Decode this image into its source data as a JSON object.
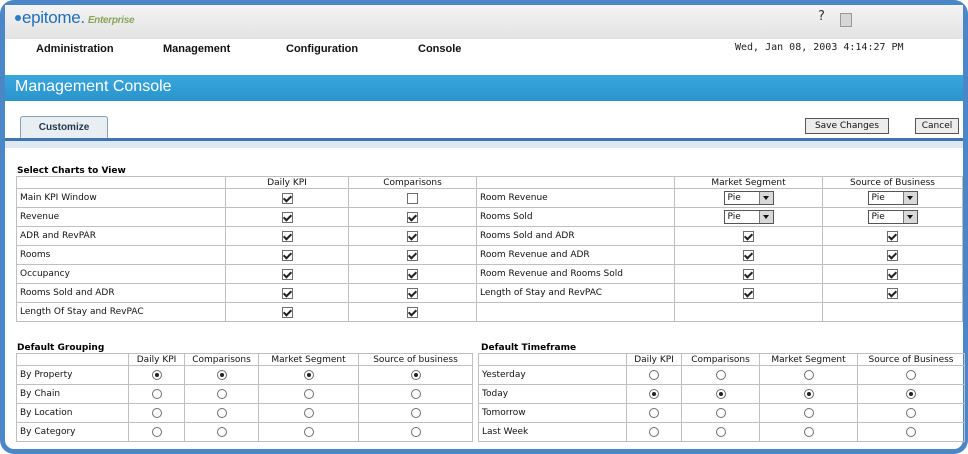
{
  "app": {
    "logo": "epitome.",
    "edition": "Enterprise",
    "help": "?"
  },
  "menu": [
    "Administration",
    "Management",
    "Configuration",
    "Console"
  ],
  "datetime": "Wed, Jan 08, 2003 4:14:27 PM",
  "page_title": "Management Console",
  "tab": "Customize",
  "buttons": {
    "save": "Save Changes",
    "cancel": "Cancel"
  },
  "select_charts": {
    "title": "Select Charts to View",
    "left": {
      "columns": [
        "Daily KPI",
        "Comparisons"
      ],
      "rows": [
        {
          "label": "Main KPI Window",
          "daily": true,
          "comp": false
        },
        {
          "label": "Revenue",
          "daily": true,
          "comp": true
        },
        {
          "label": "ADR and RevPAR",
          "daily": true,
          "comp": true
        },
        {
          "label": "Rooms",
          "daily": true,
          "comp": true
        },
        {
          "label": "Occupancy",
          "daily": true,
          "comp": true
        },
        {
          "label": "Rooms Sold and ADR",
          "daily": true,
          "comp": true
        },
        {
          "label": "Length Of Stay and RevPAC",
          "daily": true,
          "comp": true
        }
      ]
    },
    "right": {
      "columns": [
        "Market Segment",
        "Source of Business"
      ],
      "rows": [
        {
          "label": "Room Revenue",
          "market": "Pie",
          "source": "Pie"
        },
        {
          "label": "Rooms Sold",
          "market": "Pie",
          "source": "Pie"
        },
        {
          "label": "Rooms Sold and ADR",
          "market": true,
          "source": true
        },
        {
          "label": "Room Revenue and ADR",
          "market": true,
          "source": true
        },
        {
          "label": "Room Revenue and Rooms Sold",
          "market": true,
          "source": true
        },
        {
          "label": "Length of Stay and RevPAC",
          "market": true,
          "source": true
        }
      ]
    }
  },
  "default_grouping": {
    "title": "Default Grouping",
    "columns": [
      "Daily KPI",
      "Comparisons",
      "Market Segment",
      "Source of business"
    ],
    "rows": [
      {
        "label": "By Property",
        "selected": [
          true,
          true,
          true,
          true
        ]
      },
      {
        "label": "By Chain",
        "selected": [
          false,
          false,
          false,
          false
        ]
      },
      {
        "label": "By Location",
        "selected": [
          false,
          false,
          false,
          false
        ]
      },
      {
        "label": "By Category",
        "selected": [
          false,
          false,
          false,
          false
        ]
      }
    ]
  },
  "default_timeframe": {
    "title": "Default Timeframe",
    "columns": [
      "Daily KPI",
      "Comparisons",
      "Market Segment",
      "Source of Business"
    ],
    "rows": [
      {
        "label": "Yesterday",
        "selected": [
          false,
          false,
          false,
          false
        ]
      },
      {
        "label": "Today",
        "selected": [
          true,
          true,
          true,
          true
        ]
      },
      {
        "label": "Tomorrow",
        "selected": [
          false,
          false,
          false,
          false
        ]
      },
      {
        "label": "Last Week",
        "selected": [
          false,
          false,
          false,
          false
        ]
      }
    ]
  }
}
